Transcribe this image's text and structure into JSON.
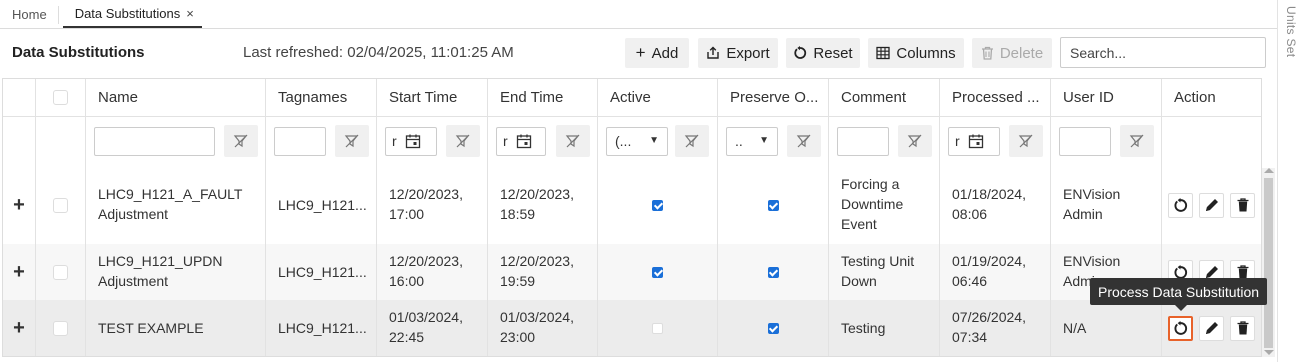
{
  "tabs": [
    {
      "label": "Home"
    },
    {
      "label": "Data Substitutions",
      "close": "×"
    }
  ],
  "side_panel": {
    "label": "Units Set"
  },
  "toolbar": {
    "title": "Data Substitutions",
    "last_refreshed": "Last refreshed: 02/04/2025, 11:01:25 AM",
    "add_label": "Add",
    "export_label": "Export",
    "reset_label": "Reset",
    "columns_label": "Columns",
    "delete_label": "Delete",
    "search_placeholder": "Search..."
  },
  "columns": [
    "Name",
    "Tagnames",
    "Start Time",
    "End Time",
    "Active",
    "Preserve O...",
    "Comment",
    "Processed ...",
    "User ID",
    "Action"
  ],
  "filters": {
    "start_time_value": "r",
    "processed_value": "r",
    "end_time_value": "r",
    "active_select": "(...",
    "preserve_select": ".."
  },
  "rows": [
    {
      "expand": "+",
      "name_line1": "LHC9_H121_A_FAULT",
      "name_line2": "Adjustment",
      "tagnames": "LHC9_H121...",
      "start_line1": "12/20/2023,",
      "start_line2": "17:00",
      "end_line1": "12/20/2023,",
      "end_line2": "18:59",
      "active": true,
      "preserve": true,
      "comment_line1": "Forcing a",
      "comment_line2": "Downtime",
      "comment_line3": "Event",
      "processed_line1": "01/18/2024,",
      "processed_line2": "08:06",
      "user_line1": "ENVision",
      "user_line2": "Admin"
    },
    {
      "expand": "+",
      "name_line1": "LHC9_H121_UPDN",
      "name_line2": "Adjustment",
      "tagnames": "LHC9_H121...",
      "start_line1": "12/20/2023,",
      "start_line2": "16:00",
      "end_line1": "12/20/2023,",
      "end_line2": "19:59",
      "active": true,
      "preserve": true,
      "comment_line1": "Testing Unit",
      "comment_line2": "Down",
      "processed_line1": "01/19/2024,",
      "processed_line2": "06:46",
      "user_line1": "ENVision",
      "user_line2": "Admin"
    },
    {
      "expand": "+",
      "name_line1": "TEST EXAMPLE",
      "tagnames": "LHC9_H121...",
      "start_line1": "01/03/2024,",
      "start_line2": "22:45",
      "end_line1": "01/03/2024,",
      "end_line2": "23:00",
      "active": false,
      "preserve": true,
      "comment_line1": "Testing",
      "processed_line1": "07/26/2024,",
      "processed_line2": "07:34",
      "user_line1": "N/A"
    }
  ],
  "tooltip": "Process Data Substitution",
  "colors": {
    "accent": "#1a6fd8",
    "focus": "#e8622a"
  }
}
